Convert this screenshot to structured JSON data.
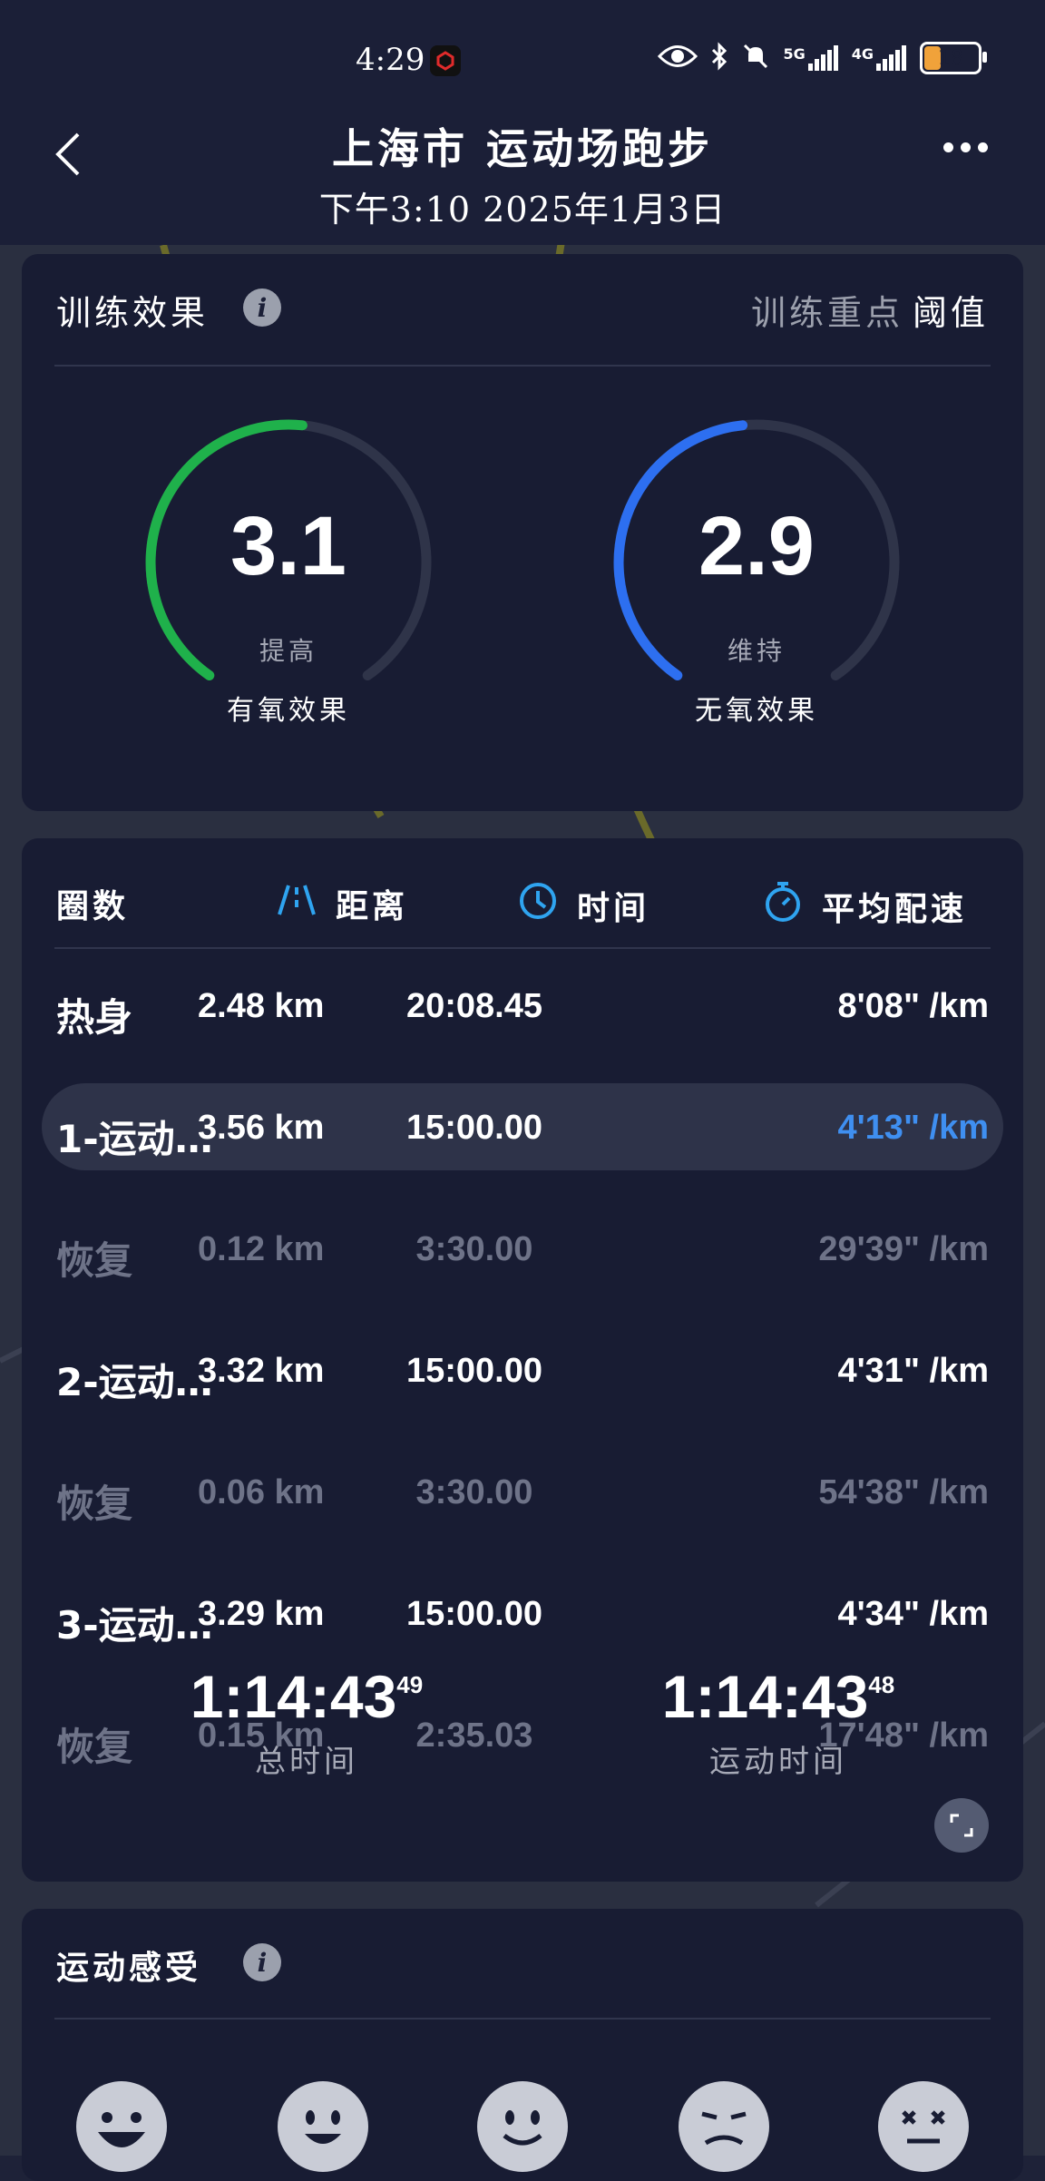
{
  "status_bar": {
    "time": "4:29",
    "signal1": "5G",
    "signal2": "4G",
    "battery": "18"
  },
  "header": {
    "title": "上海市 运动场跑步",
    "subtitle": "下午3:10 2025年1月3日"
  },
  "training_effect": {
    "title": "训练效果",
    "focus_label": "训练重点",
    "focus_value": "阈值",
    "aerobic": {
      "value": "3.1",
      "fraction": 0.52,
      "status": "提高",
      "label": "有氧效果",
      "color": "#1fb14b"
    },
    "anaerobic": {
      "value": "2.9",
      "fraction": 0.48,
      "status": "维持",
      "label": "无氧效果",
      "color": "#2d6ff0"
    }
  },
  "laps": {
    "headers": {
      "lap": "圈数",
      "distance": "距离",
      "time": "时间",
      "pace": "平均配速"
    },
    "rows": [
      {
        "name": "热身",
        "distance": "2.48 km",
        "time": "20:08.45",
        "pace": "8'08\" /km",
        "dim": false,
        "highlight": false
      },
      {
        "name": "1-运动…",
        "distance": "3.56 km",
        "time": "15:00.00",
        "pace": "4'13\" /km",
        "dim": false,
        "highlight": true
      },
      {
        "name": "恢复",
        "distance": "0.12 km",
        "time": "3:30.00",
        "pace": "29'39\" /km",
        "dim": true,
        "highlight": false
      },
      {
        "name": "2-运动…",
        "distance": "3.32 km",
        "time": "15:00.00",
        "pace": "4'31\" /km",
        "dim": false,
        "highlight": false
      },
      {
        "name": "恢复",
        "distance": "0.06 km",
        "time": "3:30.00",
        "pace": "54'38\" /km",
        "dim": true,
        "highlight": false
      },
      {
        "name": "3-运动…",
        "distance": "3.29 km",
        "time": "15:00.00",
        "pace": "4'34\" /km",
        "dim": false,
        "highlight": false
      },
      {
        "name": "恢复",
        "distance": "0.15 km",
        "time": "2:35.03",
        "pace": "17'48\" /km",
        "dim": true,
        "highlight": false
      }
    ],
    "total_time": {
      "main": "1:14:43",
      "sub": "49",
      "label": "总时间"
    },
    "moving_time": {
      "main": "1:14:43",
      "sub": "48",
      "label": "运动时间"
    }
  },
  "feeling": {
    "title": "运动感受"
  },
  "colors": {
    "accent_blue": "#3f8ff0",
    "gauge_track": "#2f3449"
  }
}
